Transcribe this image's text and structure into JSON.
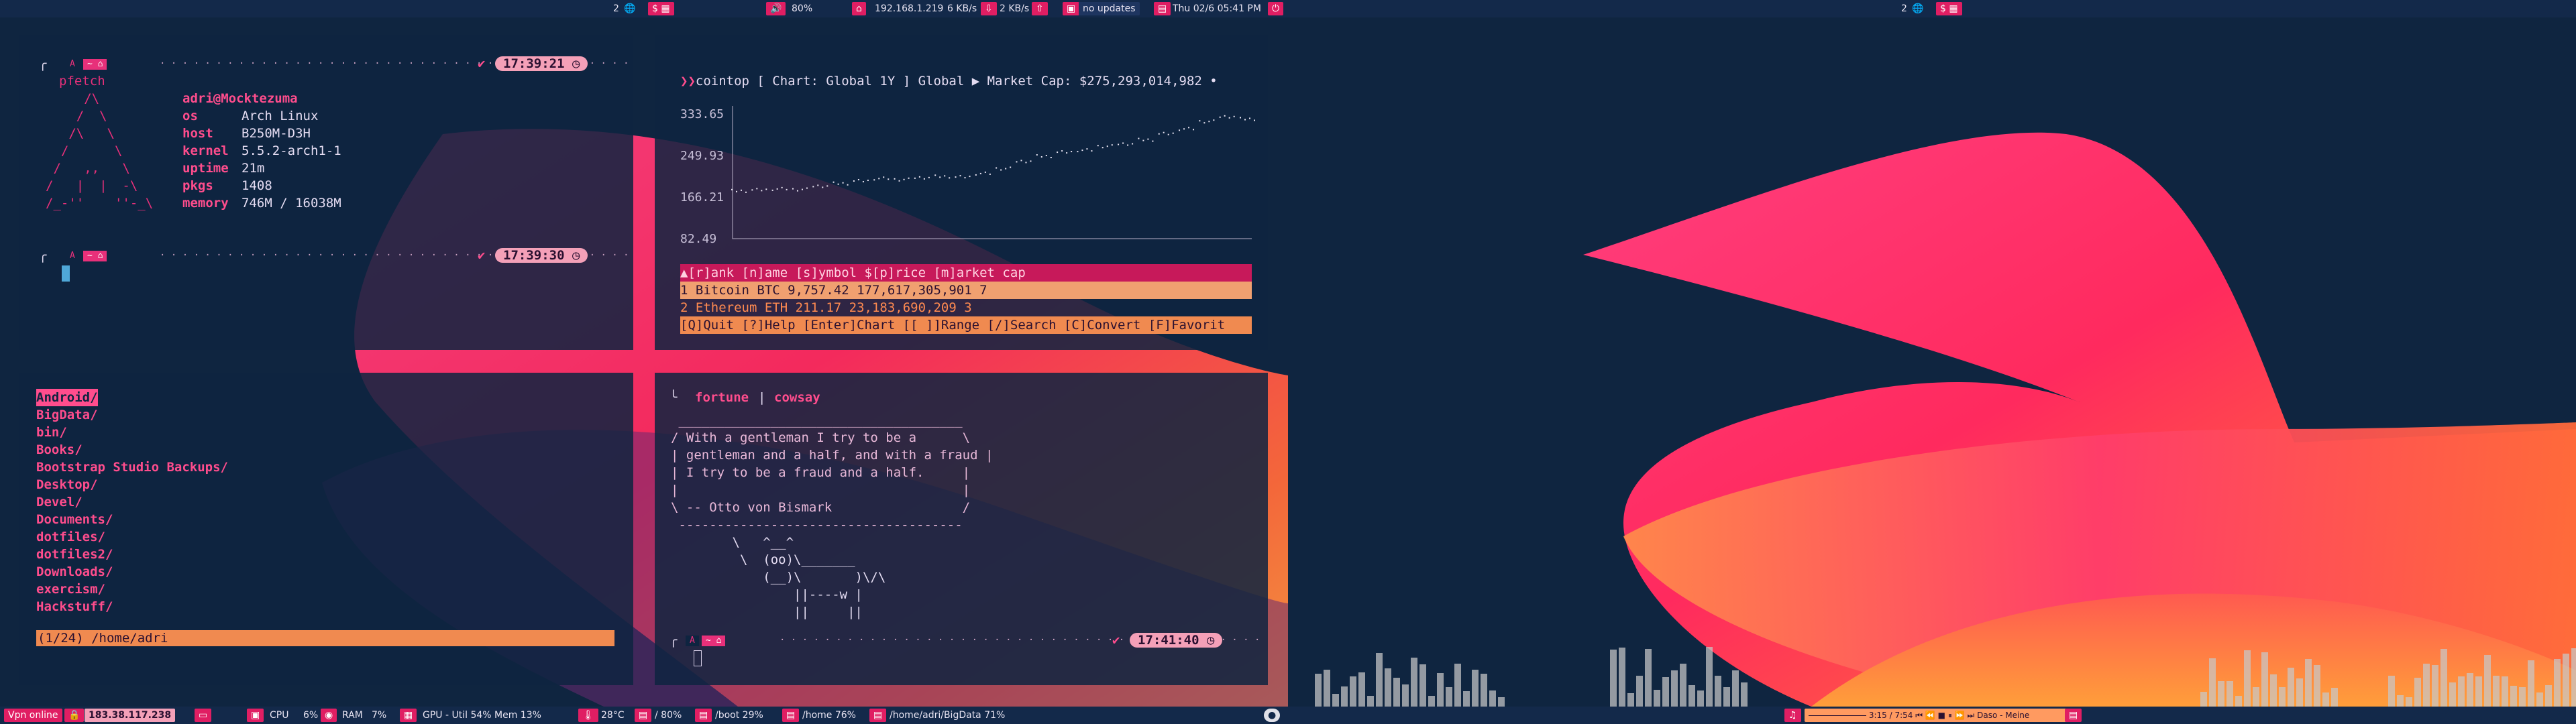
{
  "top_bar": {
    "left_workspace": "2",
    "left_tag": "$",
    "volume": "80%",
    "ip": "192.168.1.219",
    "down": "6 KB/s",
    "up": "2 KB/s",
    "updates": "no updates",
    "datetime": "Thu 02/6   05:41 PM",
    "right_workspace": "2",
    "right_tag": "$"
  },
  "pfetch_term": {
    "prompt_user": "A",
    "prompt_dir": "~",
    "clock1": "17:39:21",
    "command": "pfetch",
    "logo": [
      "     /\\",
      "    /  \\",
      "   /\\   \\",
      "  /      \\",
      " /   ,,   \\",
      "/   |  |  -\\",
      "/_-''    ''-_\\"
    ],
    "title": "adri@Mocktezuma",
    "rows": [
      {
        "key": "os",
        "val": "Arch Linux"
      },
      {
        "key": "host",
        "val": "B250M-D3H"
      },
      {
        "key": "kernel",
        "val": "5.5.2-arch1-1"
      },
      {
        "key": "uptime",
        "val": "21m"
      },
      {
        "key": "pkgs",
        "val": "1408"
      },
      {
        "key": "memory",
        "val": "746M / 16038M"
      }
    ],
    "clock2": "17:39:30"
  },
  "cointop": {
    "header": "cointop [ Chart: Global 1Y ] Global ▶ Market Cap: $275,293,014,982 •",
    "yticks": [
      "333.65",
      "249.93",
      "166.21",
      "82.49"
    ],
    "table_head": "▲[r]ank  [n]ame           [s]ymbol  $[p]rice      [m]arket cap",
    "rows": [
      "      1  Bitcoin          BTC        9,757.42   177,617,305,901  7",
      "      2  Ethereum         ETH          211.17    23,183,690,209  3"
    ],
    "footer": "[Q]Quit [?]Help [Enter]Chart [[ ]]Range [/]Search [C]Convert [F]Favorit",
    "chart_data": {
      "type": "line",
      "x": [
        "1",
        "2",
        "3",
        "4",
        "5",
        "6",
        "7",
        "8",
        "9",
        "10",
        "11",
        "12",
        "13",
        "14",
        "15",
        "16",
        "17",
        "18",
        "19",
        "20",
        "21",
        "22",
        "23",
        "24",
        "25",
        "26"
      ],
      "y": [
        180,
        182,
        184,
        183,
        190,
        195,
        200,
        205,
        203,
        207,
        209,
        208,
        215,
        225,
        240,
        250,
        258,
        262,
        270,
        275,
        283,
        295,
        305,
        320,
        330,
        325
      ],
      "ylim": [
        82.49,
        350
      ]
    }
  },
  "ranger": {
    "items": [
      "Android/",
      "BigData/",
      "bin/",
      "Books/",
      "Bootstrap Studio Backups/",
      "Desktop/",
      "Devel/",
      "Documents/",
      "dotfiles/",
      "dotfiles2/",
      "Downloads/",
      "exercism/",
      "Hackstuff/"
    ],
    "status": "(1/24) /home/adri"
  },
  "fortune": {
    "command_a": "fortune",
    "pipe": "|",
    "command_b": "cowsay",
    "lines": [
      " _____________________________________",
      "/ With a gentleman I try to be a      \\",
      "| gentleman and a half, and with a fraud |",
      "| I try to be a fraud and a half.     |",
      "|                                     |",
      "\\ -- Otto von Bismark                 /",
      " -------------------------------------",
      "        \\   ^__^",
      "         \\  (oo)\\_______",
      "            (__)\\       )\\/\\",
      "                ||----w |",
      "                ||     ||"
    ],
    "clock": "17:41:40"
  },
  "bottom_bar": {
    "vpn": "Vpn online",
    "ext_ip": "183.38.117.238",
    "cpu_label": "CPU",
    "cpu": "6%",
    "ram_label": "RAM",
    "ram": "7%",
    "gpu": "GPU - Util 54% Mem 13%",
    "temp": "28°C",
    "root": "/ 80%",
    "boot": "/boot 29%",
    "home": "/home 76%",
    "bigdata": "/home/adri/BigData 71%",
    "player_time": "3:15 / 7:54",
    "player_track": "Daso - Meine"
  },
  "colors": {
    "accent": "#e8307a",
    "bar": "#13294a",
    "term": "#0e2440",
    "orange": "#ff8a50"
  }
}
